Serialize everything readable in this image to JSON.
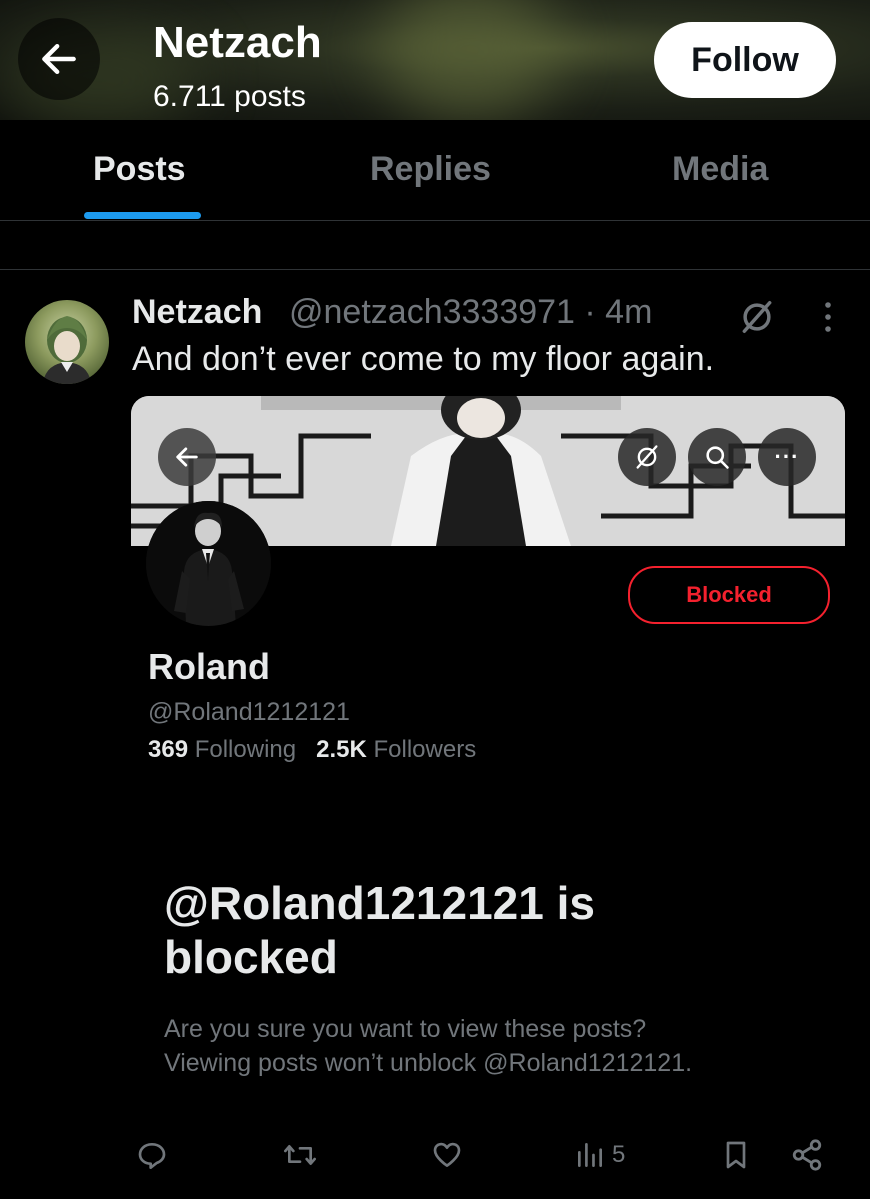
{
  "header": {
    "title": "Netzach",
    "subtitle": "6.711 posts",
    "follow_label": "Follow",
    "back_icon": "arrow-left-icon"
  },
  "tabs": [
    {
      "label": "Posts",
      "active": true
    },
    {
      "label": "Replies",
      "active": false
    },
    {
      "label": "Media",
      "active": false
    }
  ],
  "tweet": {
    "author_name": "Netzach",
    "author_handle": "@netzach3333971 · 4m",
    "text": "And don’t ever come to my floor again.",
    "embed": {
      "name": "Roland",
      "handle": "@Roland1212121",
      "following_count": "369",
      "following_label": "Following",
      "followers_count": "2.5K",
      "followers_label": "Followers",
      "blocked_label": "Blocked",
      "blocked_title": "@Roland1212121 is blocked",
      "blocked_body_line1": "Are you sure you want to view these posts?",
      "blocked_body_line2": "Viewing posts won’t unblock @Roland1212121.",
      "more_glyph": "···"
    },
    "actions": {
      "views_count": "5"
    }
  },
  "colors": {
    "accent": "#1d9bf0",
    "blocked_red": "#f4212e",
    "muted": "#71767b",
    "text": "#e7e9ea"
  }
}
